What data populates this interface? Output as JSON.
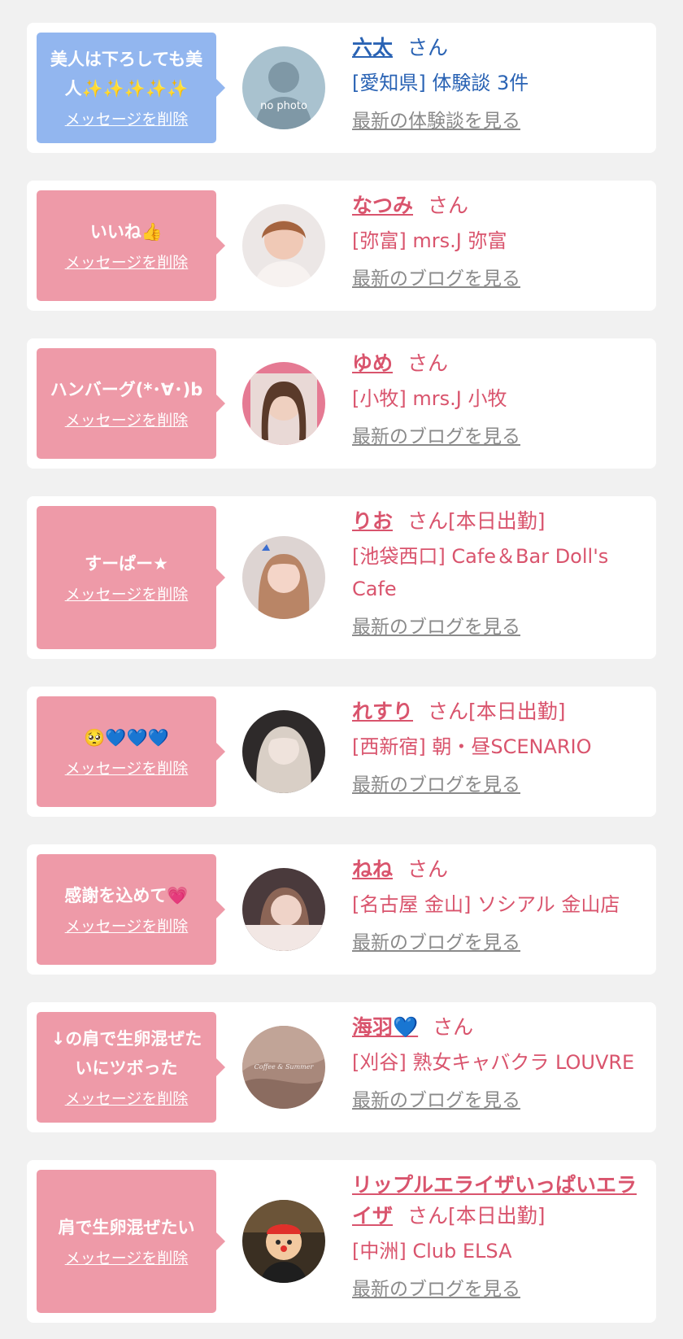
{
  "delete_label": "メッセージを削除",
  "san_label": "さん",
  "colors": {
    "pink_bubble": "#ee9aa8",
    "blue_bubble": "#92b6ef",
    "pink_text": "#d9546d",
    "blue_text": "#2a63b4",
    "link_gray": "#8a8a8a",
    "background": "#f1f1f1"
  },
  "items": [
    {
      "message": "美人は下ろしても美人✨✨✨✨✨",
      "name": "六太",
      "badge": "",
      "shop": "[愛知県] 体験談 3件",
      "link": "最新の体験談を見る",
      "avatar_caption": "no photo",
      "theme": "blue"
    },
    {
      "message": "いいね👍",
      "name": "なつみ",
      "badge": "",
      "shop": "[弥富] mrs.J 弥富",
      "link": "最新のブログを見る",
      "theme": "pink"
    },
    {
      "message": "ハンバーグ(*･∀･)b",
      "name": "ゆめ",
      "badge": "",
      "shop": "[小牧] mrs.J 小牧",
      "link": "最新のブログを見る",
      "theme": "pink"
    },
    {
      "message": "すーぱー★",
      "name": "りお",
      "badge": "[本日出勤]",
      "shop": "[池袋西口] Cafe＆Bar Doll's Cafe",
      "link": "最新のブログを見る",
      "theme": "pink"
    },
    {
      "message": "🥺💙💙💙",
      "name": "れすり",
      "badge": "[本日出勤]",
      "shop": "[西新宿] 朝・昼SCENARIO",
      "link": "最新のブログを見る",
      "theme": "pink"
    },
    {
      "message": "感謝を込めて💗",
      "name": "ねね",
      "badge": "",
      "shop": "[名古屋 金山] ソシアル 金山店",
      "link": "最新のブログを見る",
      "theme": "pink"
    },
    {
      "message": "↓の肩で生卵混ぜたいにツボった",
      "name": "海羽💙",
      "badge": "",
      "shop": "[刈谷] 熟女キャバクラ LOUVRE",
      "link": "最新のブログを見る",
      "avatar_caption": "Coffee & Summer",
      "theme": "pink"
    },
    {
      "message": "肩で生卵混ぜたい",
      "name": "リップルエライザいっぱいエライザ",
      "badge": "[本日出勤]",
      "shop": "[中洲] Club ELSA",
      "link": "最新のブログを見る",
      "theme": "pink"
    }
  ]
}
